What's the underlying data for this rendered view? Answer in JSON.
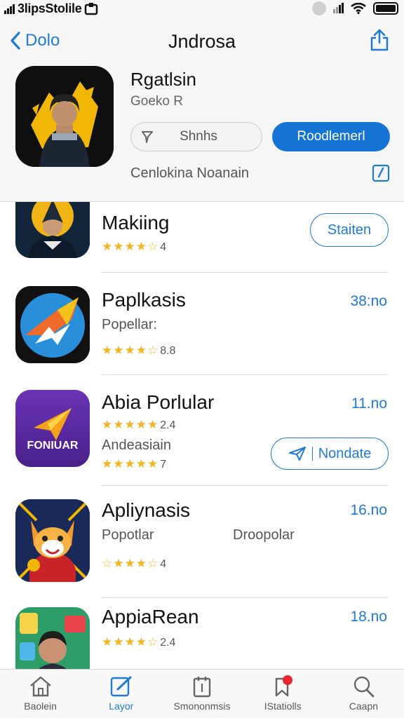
{
  "status_bar": {
    "carrier": "3lipsStolile"
  },
  "nav": {
    "back_label": "Dolo",
    "title": "Jndrosa"
  },
  "hero": {
    "name": "Rgatlsin",
    "subtitle": "Goeko R",
    "secondary_button": "Shnhs",
    "primary_button": "Roodlemerl",
    "caption": "Cenlokina Noanain"
  },
  "apps": [
    {
      "title": "Makiing",
      "rating": "4",
      "action": "Staiten"
    },
    {
      "title": "Paplkasis",
      "subtitle": "Popellar:",
      "rating": "8.8",
      "price": "38:no"
    },
    {
      "title": "Abia Porlular",
      "rating": "2.4",
      "subtitle": "Andeasiain",
      "rating2": "7",
      "price": "11.no",
      "action": "Nondate",
      "icon_text": "FONIUAR"
    },
    {
      "title": "Apliynasis",
      "subtitle": "Popotlar",
      "subtitle2": "Droopolar",
      "rating": "4",
      "price": "16.no"
    },
    {
      "title": "AppiaRean",
      "rating": "2.4",
      "price": "18.no"
    }
  ],
  "tabs": [
    {
      "label": "Baolein",
      "icon": "home-icon"
    },
    {
      "label": "Layor",
      "icon": "compose-icon",
      "active": true
    },
    {
      "label": "Smononmsis",
      "icon": "document-icon"
    },
    {
      "label": "IStatiolls",
      "icon": "bookmark-badge-icon"
    },
    {
      "label": "Caapn",
      "icon": "search-icon"
    }
  ],
  "colors": {
    "accent": "#1f7ad6",
    "primary_button": "#1574d4",
    "stars": "#f3b420",
    "badge": "#e8262c"
  }
}
